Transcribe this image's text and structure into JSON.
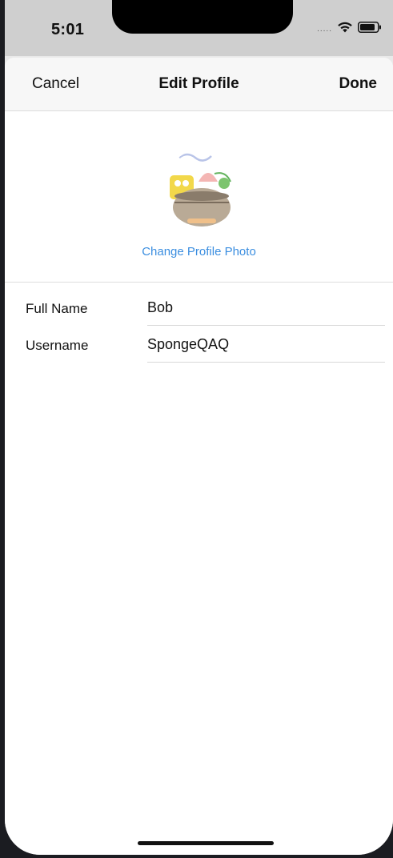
{
  "status_bar": {
    "time": "5:01",
    "signal": "....."
  },
  "nav": {
    "cancel_label": "Cancel",
    "title": "Edit Profile",
    "done_label": "Done"
  },
  "profile": {
    "change_photo_label": "Change Profile Photo"
  },
  "form": {
    "fields": [
      {
        "label": "Full Name",
        "value": "Bob"
      },
      {
        "label": "Username",
        "value": "SpongeQAQ"
      }
    ]
  },
  "colors": {
    "link": "#3b8ee0",
    "background": "#ffffff",
    "status_bar": "#cfcfcf"
  },
  "icons": [
    "wifi-icon",
    "battery-icon"
  ]
}
